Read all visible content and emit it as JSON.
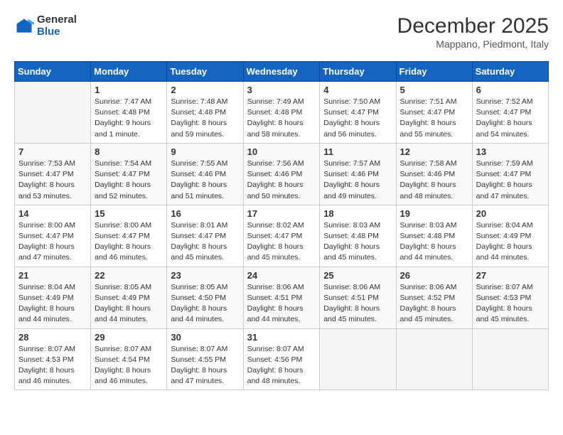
{
  "logo": {
    "general": "General",
    "blue": "Blue"
  },
  "header": {
    "month": "December 2025",
    "location": "Mappano, Piedmont, Italy"
  },
  "days_of_week": [
    "Sunday",
    "Monday",
    "Tuesday",
    "Wednesday",
    "Thursday",
    "Friday",
    "Saturday"
  ],
  "weeks": [
    [
      {
        "day": "",
        "info": ""
      },
      {
        "day": "1",
        "info": "Sunrise: 7:47 AM\nSunset: 4:48 PM\nDaylight: 9 hours\nand 1 minute."
      },
      {
        "day": "2",
        "info": "Sunrise: 7:48 AM\nSunset: 4:48 PM\nDaylight: 8 hours\nand 59 minutes."
      },
      {
        "day": "3",
        "info": "Sunrise: 7:49 AM\nSunset: 4:48 PM\nDaylight: 8 hours\nand 58 minutes."
      },
      {
        "day": "4",
        "info": "Sunrise: 7:50 AM\nSunset: 4:47 PM\nDaylight: 8 hours\nand 56 minutes."
      },
      {
        "day": "5",
        "info": "Sunrise: 7:51 AM\nSunset: 4:47 PM\nDaylight: 8 hours\nand 55 minutes."
      },
      {
        "day": "6",
        "info": "Sunrise: 7:52 AM\nSunset: 4:47 PM\nDaylight: 8 hours\nand 54 minutes."
      }
    ],
    [
      {
        "day": "7",
        "info": "Sunrise: 7:53 AM\nSunset: 4:47 PM\nDaylight: 8 hours\nand 53 minutes."
      },
      {
        "day": "8",
        "info": "Sunrise: 7:54 AM\nSunset: 4:47 PM\nDaylight: 8 hours\nand 52 minutes."
      },
      {
        "day": "9",
        "info": "Sunrise: 7:55 AM\nSunset: 4:46 PM\nDaylight: 8 hours\nand 51 minutes."
      },
      {
        "day": "10",
        "info": "Sunrise: 7:56 AM\nSunset: 4:46 PM\nDaylight: 8 hours\nand 50 minutes."
      },
      {
        "day": "11",
        "info": "Sunrise: 7:57 AM\nSunset: 4:46 PM\nDaylight: 8 hours\nand 49 minutes."
      },
      {
        "day": "12",
        "info": "Sunrise: 7:58 AM\nSunset: 4:46 PM\nDaylight: 8 hours\nand 48 minutes."
      },
      {
        "day": "13",
        "info": "Sunrise: 7:59 AM\nSunset: 4:47 PM\nDaylight: 8 hours\nand 47 minutes."
      }
    ],
    [
      {
        "day": "14",
        "info": "Sunrise: 8:00 AM\nSunset: 4:47 PM\nDaylight: 8 hours\nand 47 minutes."
      },
      {
        "day": "15",
        "info": "Sunrise: 8:00 AM\nSunset: 4:47 PM\nDaylight: 8 hours\nand 46 minutes."
      },
      {
        "day": "16",
        "info": "Sunrise: 8:01 AM\nSunset: 4:47 PM\nDaylight: 8 hours\nand 45 minutes."
      },
      {
        "day": "17",
        "info": "Sunrise: 8:02 AM\nSunset: 4:47 PM\nDaylight: 8 hours\nand 45 minutes."
      },
      {
        "day": "18",
        "info": "Sunrise: 8:03 AM\nSunset: 4:48 PM\nDaylight: 8 hours\nand 45 minutes."
      },
      {
        "day": "19",
        "info": "Sunrise: 8:03 AM\nSunset: 4:48 PM\nDaylight: 8 hours\nand 44 minutes."
      },
      {
        "day": "20",
        "info": "Sunrise: 8:04 AM\nSunset: 4:49 PM\nDaylight: 8 hours\nand 44 minutes."
      }
    ],
    [
      {
        "day": "21",
        "info": "Sunrise: 8:04 AM\nSunset: 4:49 PM\nDaylight: 8 hours\nand 44 minutes."
      },
      {
        "day": "22",
        "info": "Sunrise: 8:05 AM\nSunset: 4:49 PM\nDaylight: 8 hours\nand 44 minutes."
      },
      {
        "day": "23",
        "info": "Sunrise: 8:05 AM\nSunset: 4:50 PM\nDaylight: 8 hours\nand 44 minutes."
      },
      {
        "day": "24",
        "info": "Sunrise: 8:06 AM\nSunset: 4:51 PM\nDaylight: 8 hours\nand 44 minutes."
      },
      {
        "day": "25",
        "info": "Sunrise: 8:06 AM\nSunset: 4:51 PM\nDaylight: 8 hours\nand 45 minutes."
      },
      {
        "day": "26",
        "info": "Sunrise: 8:06 AM\nSunset: 4:52 PM\nDaylight: 8 hours\nand 45 minutes."
      },
      {
        "day": "27",
        "info": "Sunrise: 8:07 AM\nSunset: 4:53 PM\nDaylight: 8 hours\nand 45 minutes."
      }
    ],
    [
      {
        "day": "28",
        "info": "Sunrise: 8:07 AM\nSunset: 4:53 PM\nDaylight: 8 hours\nand 46 minutes."
      },
      {
        "day": "29",
        "info": "Sunrise: 8:07 AM\nSunset: 4:54 PM\nDaylight: 8 hours\nand 46 minutes."
      },
      {
        "day": "30",
        "info": "Sunrise: 8:07 AM\nSunset: 4:55 PM\nDaylight: 8 hours\nand 47 minutes."
      },
      {
        "day": "31",
        "info": "Sunrise: 8:07 AM\nSunset: 4:56 PM\nDaylight: 8 hours\nand 48 minutes."
      },
      {
        "day": "",
        "info": ""
      },
      {
        "day": "",
        "info": ""
      },
      {
        "day": "",
        "info": ""
      }
    ]
  ]
}
